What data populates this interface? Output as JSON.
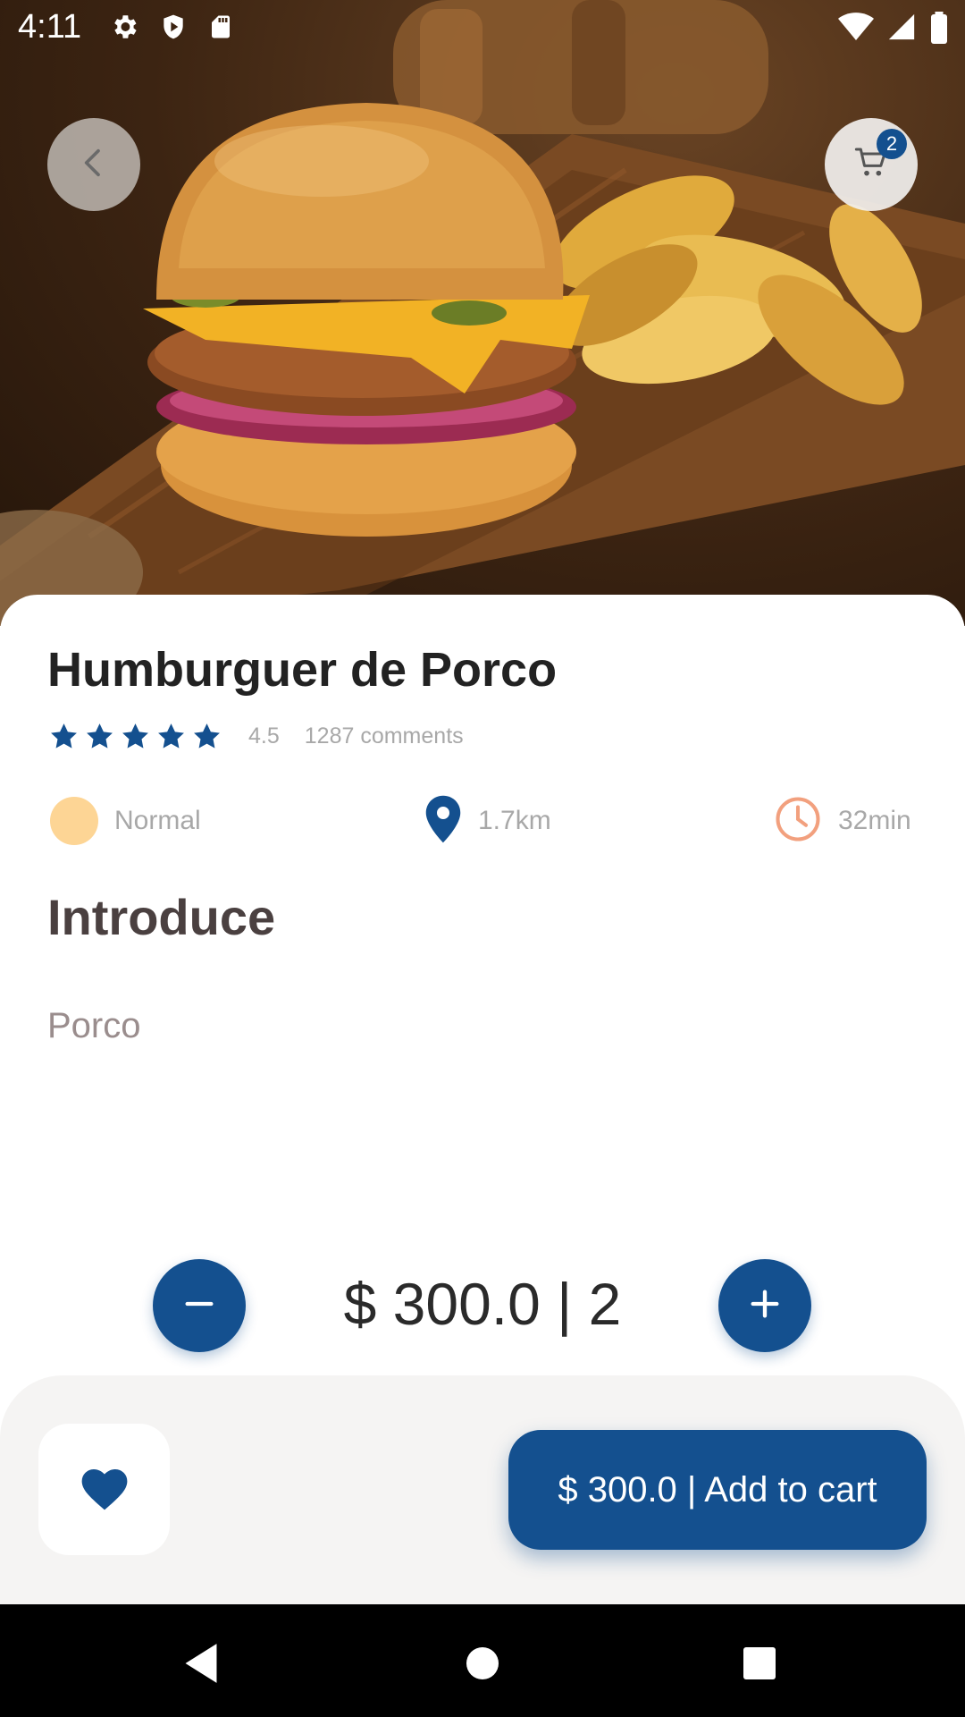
{
  "status_bar": {
    "time": "4:11",
    "left_icons": [
      "settings-icon",
      "shield-icon",
      "sd-card-icon"
    ],
    "right_icons": [
      "wifi-icon",
      "signal-icon",
      "battery-icon"
    ]
  },
  "header": {
    "back_icon": "chevron-left-icon",
    "cart_icon": "shopping-cart-icon",
    "cart_count": "2"
  },
  "product": {
    "image_description": "hamburger-with-potato-wedges",
    "title": "Humburguer de Porco",
    "rating_stars": 5,
    "rating_value": "4.5",
    "comments": "1287 comments",
    "info": {
      "level": "Normal",
      "distance": "1.7km",
      "time": "32min"
    },
    "section_heading": "Introduce",
    "description": "Porco"
  },
  "quantity": {
    "price_quantity_text": "$ 300.0 | 2"
  },
  "bottom_bar": {
    "favorite_icon": "heart-icon",
    "add_to_cart_label": "$ 300.0 | Add to cart"
  },
  "colors": {
    "primary": "#14508f",
    "star": "#14508f",
    "normal_dot": "#fdd595",
    "clock": "#f2a07e",
    "muted_text": "#a8a8a8"
  }
}
